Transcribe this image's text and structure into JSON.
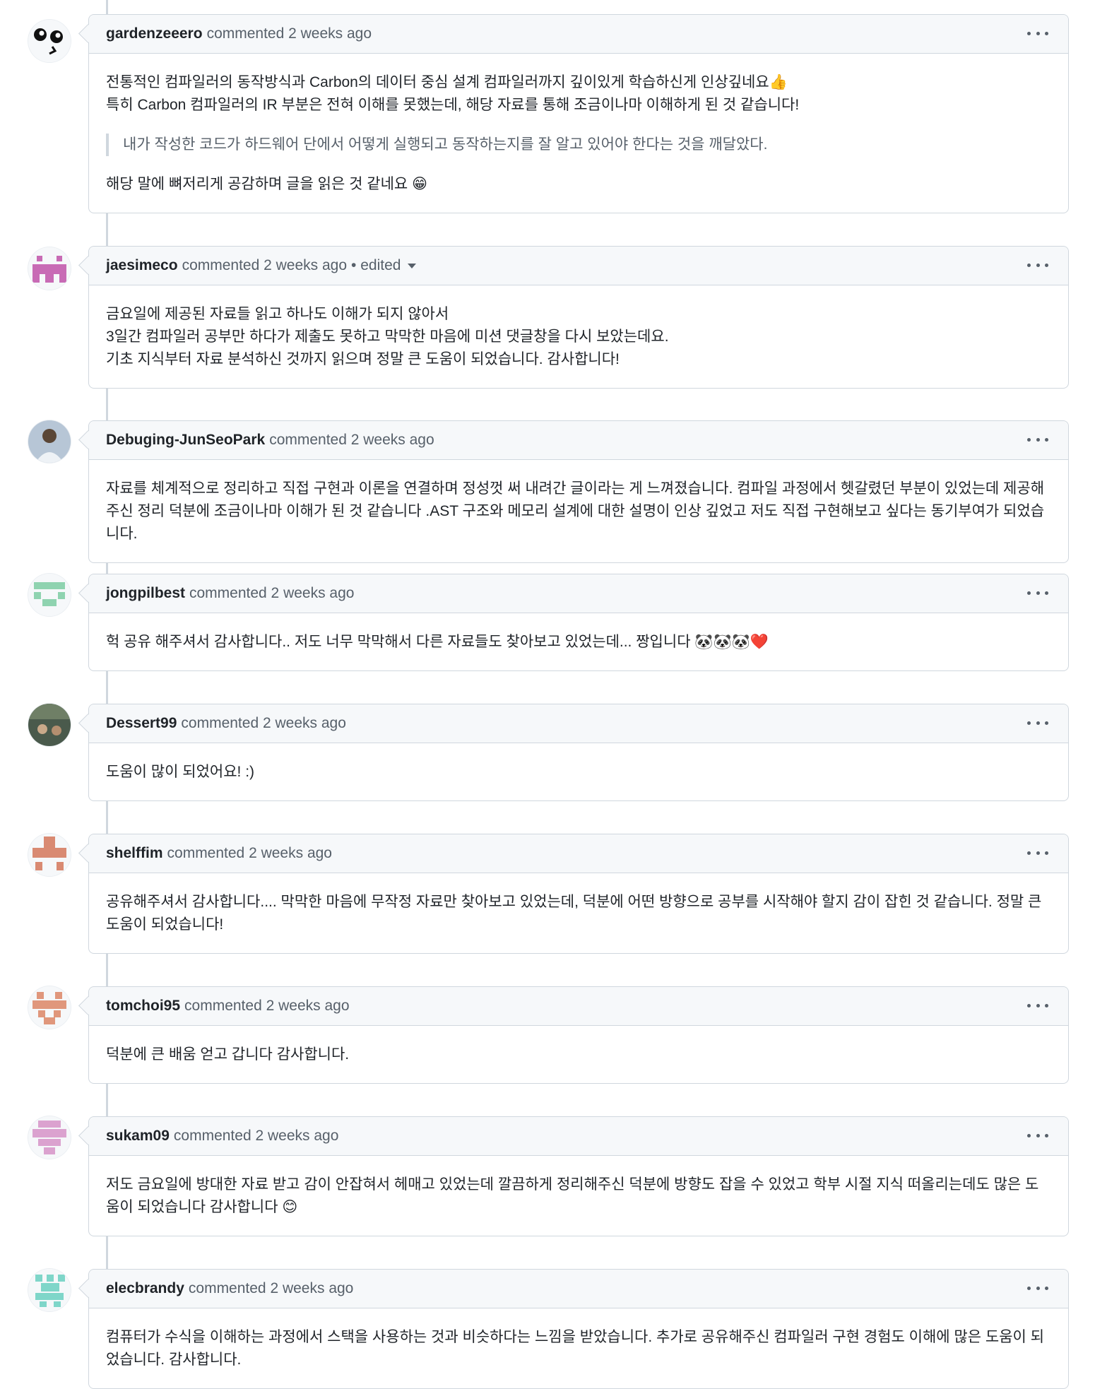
{
  "comments": [
    {
      "author": "gardenzeeero",
      "meta": "commented 2 weeks ago",
      "lines": [
        "전통적인 컴파일러의 동작방식과 Carbon의 데이터 중심 설계 컴파일러까지 깊이있게 학습하신게 인상깊네요👍",
        "특히 Carbon 컴파일러의 IR 부분은 전혀 이해를 못했는데, 해당 자료를 통해 조금이나마 이해하게 된 것 같습니다!"
      ],
      "quote": "내가 작성한 코드가 하드웨어 단에서 어떻게 실행되고 동작하는지를 잘 알고 있어야 한다는 것을 깨달았다.",
      "after_quote": "해당 말에 뼈저리게 공감하며 글을 읽은 것 같네요 😁"
    },
    {
      "author": "jaesimeco",
      "meta": "commented 2 weeks ago",
      "edited": "• edited",
      "lines": [
        "금요일에 제공된 자료들 읽고 하나도 이해가 되지 않아서",
        "3일간 컴파일러 공부만 하다가 제출도 못하고 막막한 마음에 미션 댓글창을 다시 보았는데요.",
        "기초 지식부터 자료 분석하신 것까지 읽으며 정말 큰 도움이 되었습니다. 감사합니다!"
      ]
    },
    {
      "author": "Debuging-JunSeoPark",
      "meta": "commented 2 weeks ago",
      "lines": [
        "자료를 체계적으로 정리하고 직접 구현과 이론을 연결하며 정성껏 써 내려간 글이라는 게 느껴졌습니다. 컴파일 과정에서 헷갈렸던 부분이 있었는데 제공해주신 정리 덕분에 조금이나마 이해가 된 것 같습니다 .AST 구조와 메모리 설계에 대한 설명이 인상 깊었고 저도 직접 구현해보고 싶다는 동기부여가 되었습니다."
      ]
    },
    {
      "author": "jongpilbest",
      "meta": "commented 2 weeks ago",
      "lines": [
        "헉 공유 해주셔서 감사합니다.. 저도 너무 막막해서 다른 자료들도 찾아보고 있었는데... 짱입니다 🐼🐼🐼❤️"
      ]
    },
    {
      "author": "Dessert99",
      "meta": "commented 2 weeks ago",
      "lines": [
        "도움이 많이 되었어요! :)"
      ]
    },
    {
      "author": "shelffim",
      "meta": "commented 2 weeks ago",
      "lines": [
        "공유해주셔서 감사합니다.... 막막한 마음에 무작정 자료만 찾아보고 있었는데, 덕분에 어떤 방향으로 공부를 시작해야 할지 감이 잡힌 것 같습니다. 정말 큰 도움이 되었습니다!"
      ]
    },
    {
      "author": "tomchoi95",
      "meta": "commented 2 weeks ago",
      "lines": [
        "덕분에 큰 배움 얻고 갑니다 감사합니다."
      ]
    },
    {
      "author": "sukam09",
      "meta": "commented 2 weeks ago",
      "lines": [
        "저도 금요일에 방대한 자료 받고 감이 안잡혀서 헤매고 있었는데 깔끔하게 정리해주신 덕분에 방향도 잡을 수 있었고 학부 시절 지식 떠올리는데도 많은 도움이 되었습니다 감사합니다 😊"
      ]
    },
    {
      "author": "elecbrandy",
      "meta": "commented 2 weeks ago",
      "lines": [
        "컴퓨터가 수식을 이해하는 과정에서 스택을 사용하는 것과 비슷하다는 느낌을 받았습니다. 추가로 공유해주신 컴파일러 구현 경험도 이해에 많은 도움이 되었습니다. 감사합니다."
      ]
    }
  ]
}
